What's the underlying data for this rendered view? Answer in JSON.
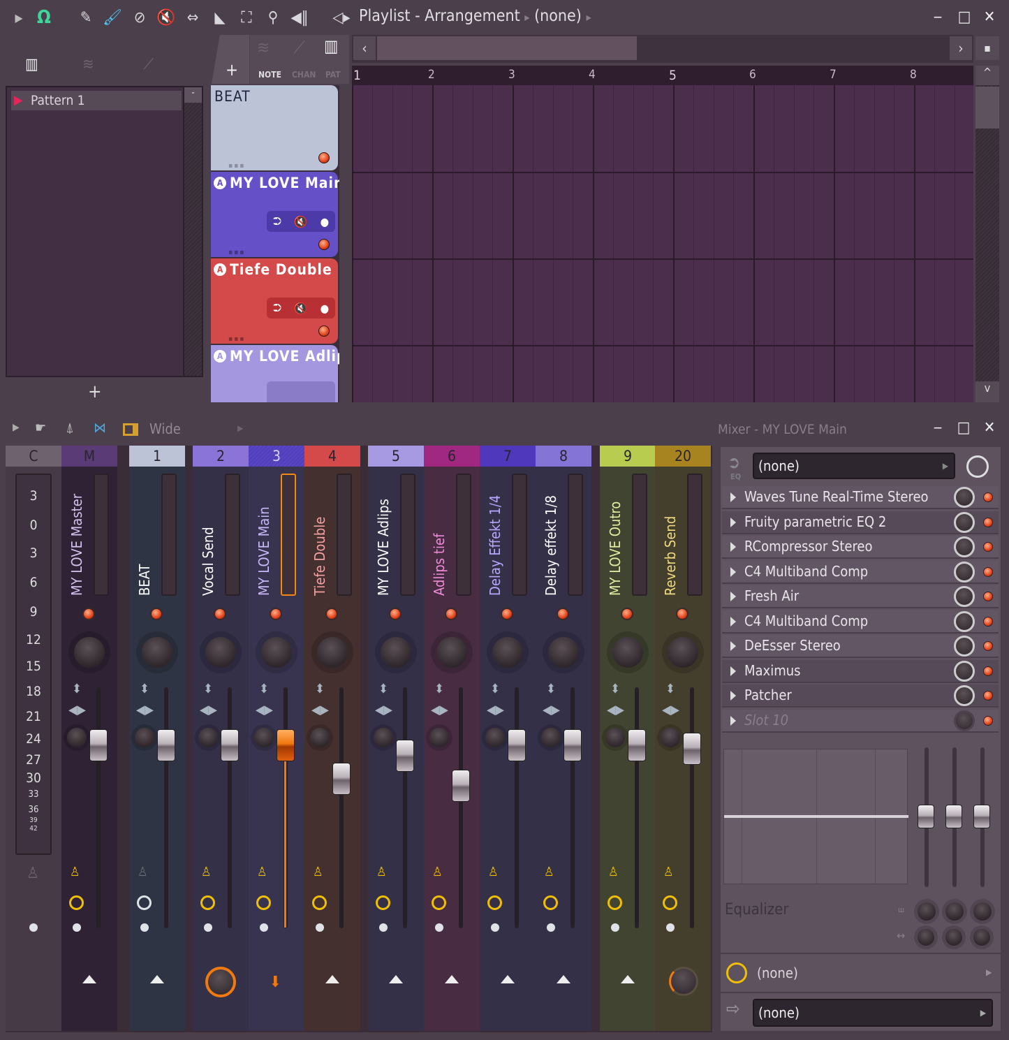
{
  "toolbar": {
    "icons": [
      "play-arrow-icon",
      "magnet-snap-icon",
      "pencil-icon",
      "paint-brush-icon",
      "delete-icon",
      "mute-icon",
      "slip-icon",
      "slice-icon",
      "select-icon",
      "zoom-icon",
      "playback-icon"
    ],
    "title": "Playlist - Arrangement",
    "breadcrumb_sep": "▸",
    "pattern_selector": "(none)",
    "window_buttons": {
      "minimize": "‒",
      "maximize": "□",
      "close": "✕"
    }
  },
  "browser": {
    "tabs": [
      "piano-roll",
      "audio",
      "automation"
    ],
    "patterns": [
      {
        "label": "Pattern 1"
      }
    ],
    "collapse_label": "-",
    "add_label": "+"
  },
  "playlist": {
    "filter_tabs": [
      "NOTE",
      "CHAN",
      "PAT"
    ],
    "add_label": "+",
    "bar_numbers": [
      "1",
      "2",
      "3",
      "4",
      "5",
      "6",
      "7",
      "8"
    ],
    "tracks": [
      {
        "name": "BEAT",
        "color": "#bcc3d6",
        "text_color": "#1e2740",
        "has_controls": false
      },
      {
        "name": "MY LOVE Main",
        "color": "#6650c8",
        "text_color": "#ffffff",
        "has_controls": true,
        "ctrl_bg": "#4b3aa8"
      },
      {
        "name": "Tiefe Double",
        "color": "#d4494a",
        "text_color": "#ffffff",
        "has_controls": true,
        "ctrl_bg": "#b83034"
      },
      {
        "name": "MY LOVE Adlips",
        "color": "#a497e0",
        "text_color": "#ffffff",
        "has_controls": false,
        "ctrl_bg": "#8a7cc6"
      }
    ],
    "scroll_left": "‹",
    "scroll_right": "›",
    "scroll_up": "^",
    "scroll_down": "v"
  },
  "mixer": {
    "title": "Mixer - MY LOVE Main",
    "view_mode": "Wide",
    "scale": [
      "3",
      "0",
      "3",
      "6",
      "9",
      "12",
      "15",
      "18",
      "21",
      "24",
      "27",
      "30",
      "33",
      "36",
      "39",
      "42"
    ],
    "channels": [
      {
        "id": "C",
        "name": "",
        "hd_color": "#6e626e",
        "body": "#453a45"
      },
      {
        "id": "M",
        "name": "MY LOVE Master",
        "hd_color": "#5a3b76",
        "body": "#2e2234",
        "name_color": "#d6c2ee",
        "fader": 0.74,
        "master": true
      },
      {
        "id": "1",
        "name": "BEAT",
        "hd_color": "#bcc3d6",
        "body": "#2f3444",
        "name_color": "#ffffff",
        "fader": 0.74
      },
      {
        "id": "2",
        "name": "Vocal Send",
        "hd_color": "#8a74d8",
        "body": "#343048",
        "name_color": "#ffffff",
        "fader": 0.74
      },
      {
        "id": "3",
        "name": "MY LOVE Main",
        "hd_color": "#5a45c6",
        "body": "#383450",
        "name_color": "#c8b8f8",
        "fader": 0.74,
        "selected": true
      },
      {
        "id": "4",
        "name": "Tiefe Double",
        "hd_color": "#d44a4a",
        "body": "#44302e",
        "name_color": "#f5a0a0",
        "fader": 0.54
      },
      {
        "id": "5",
        "name": "MY LOVE Adlips",
        "hd_color": "#a89ae2",
        "body": "#343048",
        "name_color": "#ffffff",
        "fader": 0.68
      },
      {
        "id": "6",
        "name": "Adlips tief",
        "hd_color": "#a02880",
        "body": "#482c42",
        "name_color": "#f08ad8",
        "fader": 0.5
      },
      {
        "id": "7",
        "name": "Delay Effekt 1/4",
        "hd_color": "#5038bc",
        "body": "#343048",
        "name_color": "#b8a6ff",
        "fader": 0.74
      },
      {
        "id": "8",
        "name": "Delay effekt 1/8",
        "hd_color": "#8474d6",
        "body": "#343048",
        "name_color": "#ffffff",
        "fader": 0.74
      },
      {
        "id": "9",
        "name": "MY LOVE Outro",
        "hd_color": "#b8cc50",
        "body": "#414430",
        "name_color": "#e2eda0",
        "fader": 0.74
      },
      {
        "id": "20",
        "name": "Reverb Send",
        "hd_color": "#a88420",
        "body": "#443e2c",
        "name_color": "#f0da80",
        "fader": 0.72
      }
    ]
  },
  "fx": {
    "input": "(none)",
    "eq_label": "EQ",
    "slots": [
      {
        "name": "Waves Tune Real-Time Stereo",
        "active": true
      },
      {
        "name": "Fruity parametric EQ 2",
        "active": true
      },
      {
        "name": "RCompressor Stereo",
        "active": true
      },
      {
        "name": "C4 Multiband Comp",
        "active": true
      },
      {
        "name": "Fresh Air",
        "active": true
      },
      {
        "name": "C4 Multiband Comp",
        "active": true
      },
      {
        "name": "DeEsser Stereo",
        "active": true
      },
      {
        "name": "Maximus",
        "active": true
      },
      {
        "name": "Patcher",
        "active": true
      },
      {
        "name": "Slot 10",
        "active": false
      }
    ],
    "equalizer_label": "Equalizer",
    "eq_bands": [
      0.5,
      0.5,
      0.5
    ],
    "latency": "(none)",
    "output": "(none)"
  }
}
